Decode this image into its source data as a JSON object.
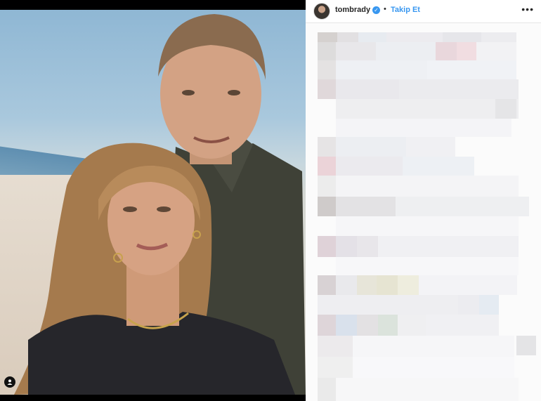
{
  "post": {
    "username": "tombrady",
    "verified_icon": "verified-badge-icon",
    "separator": "•",
    "follow_label": "Takip Et",
    "more_icon": "more-options-icon"
  },
  "photo": {
    "user_tag_icon": "user-tag-icon"
  },
  "comments": {
    "state": "pixelated"
  }
}
